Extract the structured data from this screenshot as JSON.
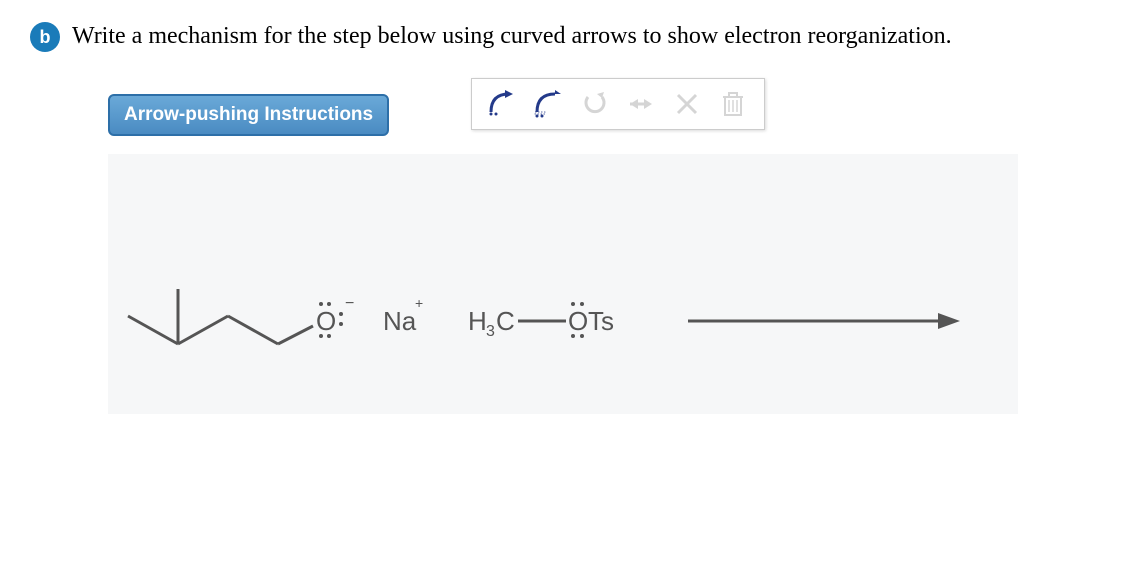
{
  "badge": {
    "label": "b"
  },
  "instruction": "Write a mechanism for the step below using curved arrows to show electron reorganization.",
  "button": {
    "label": "Arrow-pushing Instructions"
  },
  "toolbar": {
    "arrow1": "curved-arrow-full-icon",
    "arrow2": "curved-arrow-half-icon",
    "undo": "undo-icon",
    "redo": "redo-icon",
    "clear": "clear-icon",
    "delete": "trash-icon"
  },
  "chem": {
    "o_atom": "O",
    "o_charge": "−",
    "na": "Na",
    "na_charge": "+",
    "h3c": "H",
    "h3c_sub": "3",
    "h3c_c": "C",
    "ots_o": "O",
    "ots_ts": "Ts"
  }
}
